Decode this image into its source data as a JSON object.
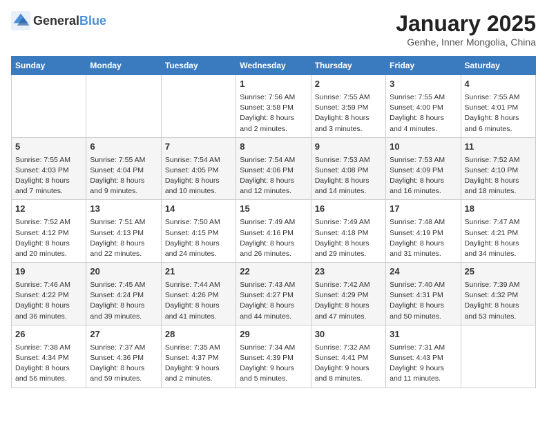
{
  "header": {
    "logo_general": "General",
    "logo_blue": "Blue",
    "title": "January 2025",
    "subtitle": "Genhe, Inner Mongolia, China"
  },
  "calendar": {
    "days_of_week": [
      "Sunday",
      "Monday",
      "Tuesday",
      "Wednesday",
      "Thursday",
      "Friday",
      "Saturday"
    ],
    "weeks": [
      [
        {
          "day": "",
          "content": ""
        },
        {
          "day": "",
          "content": ""
        },
        {
          "day": "",
          "content": ""
        },
        {
          "day": "1",
          "content": "Sunrise: 7:56 AM\nSunset: 3:58 PM\nDaylight: 8 hours\nand 2 minutes."
        },
        {
          "day": "2",
          "content": "Sunrise: 7:55 AM\nSunset: 3:59 PM\nDaylight: 8 hours\nand 3 minutes."
        },
        {
          "day": "3",
          "content": "Sunrise: 7:55 AM\nSunset: 4:00 PM\nDaylight: 8 hours\nand 4 minutes."
        },
        {
          "day": "4",
          "content": "Sunrise: 7:55 AM\nSunset: 4:01 PM\nDaylight: 8 hours\nand 6 minutes."
        }
      ],
      [
        {
          "day": "5",
          "content": "Sunrise: 7:55 AM\nSunset: 4:03 PM\nDaylight: 8 hours\nand 7 minutes."
        },
        {
          "day": "6",
          "content": "Sunrise: 7:55 AM\nSunset: 4:04 PM\nDaylight: 8 hours\nand 9 minutes."
        },
        {
          "day": "7",
          "content": "Sunrise: 7:54 AM\nSunset: 4:05 PM\nDaylight: 8 hours\nand 10 minutes."
        },
        {
          "day": "8",
          "content": "Sunrise: 7:54 AM\nSunset: 4:06 PM\nDaylight: 8 hours\nand 12 minutes."
        },
        {
          "day": "9",
          "content": "Sunrise: 7:53 AM\nSunset: 4:08 PM\nDaylight: 8 hours\nand 14 minutes."
        },
        {
          "day": "10",
          "content": "Sunrise: 7:53 AM\nSunset: 4:09 PM\nDaylight: 8 hours\nand 16 minutes."
        },
        {
          "day": "11",
          "content": "Sunrise: 7:52 AM\nSunset: 4:10 PM\nDaylight: 8 hours\nand 18 minutes."
        }
      ],
      [
        {
          "day": "12",
          "content": "Sunrise: 7:52 AM\nSunset: 4:12 PM\nDaylight: 8 hours\nand 20 minutes."
        },
        {
          "day": "13",
          "content": "Sunrise: 7:51 AM\nSunset: 4:13 PM\nDaylight: 8 hours\nand 22 minutes."
        },
        {
          "day": "14",
          "content": "Sunrise: 7:50 AM\nSunset: 4:15 PM\nDaylight: 8 hours\nand 24 minutes."
        },
        {
          "day": "15",
          "content": "Sunrise: 7:49 AM\nSunset: 4:16 PM\nDaylight: 8 hours\nand 26 minutes."
        },
        {
          "day": "16",
          "content": "Sunrise: 7:49 AM\nSunset: 4:18 PM\nDaylight: 8 hours\nand 29 minutes."
        },
        {
          "day": "17",
          "content": "Sunrise: 7:48 AM\nSunset: 4:19 PM\nDaylight: 8 hours\nand 31 minutes."
        },
        {
          "day": "18",
          "content": "Sunrise: 7:47 AM\nSunset: 4:21 PM\nDaylight: 8 hours\nand 34 minutes."
        }
      ],
      [
        {
          "day": "19",
          "content": "Sunrise: 7:46 AM\nSunset: 4:22 PM\nDaylight: 8 hours\nand 36 minutes."
        },
        {
          "day": "20",
          "content": "Sunrise: 7:45 AM\nSunset: 4:24 PM\nDaylight: 8 hours\nand 39 minutes."
        },
        {
          "day": "21",
          "content": "Sunrise: 7:44 AM\nSunset: 4:26 PM\nDaylight: 8 hours\nand 41 minutes."
        },
        {
          "day": "22",
          "content": "Sunrise: 7:43 AM\nSunset: 4:27 PM\nDaylight: 8 hours\nand 44 minutes."
        },
        {
          "day": "23",
          "content": "Sunrise: 7:42 AM\nSunset: 4:29 PM\nDaylight: 8 hours\nand 47 minutes."
        },
        {
          "day": "24",
          "content": "Sunrise: 7:40 AM\nSunset: 4:31 PM\nDaylight: 8 hours\nand 50 minutes."
        },
        {
          "day": "25",
          "content": "Sunrise: 7:39 AM\nSunset: 4:32 PM\nDaylight: 8 hours\nand 53 minutes."
        }
      ],
      [
        {
          "day": "26",
          "content": "Sunrise: 7:38 AM\nSunset: 4:34 PM\nDaylight: 8 hours\nand 56 minutes."
        },
        {
          "day": "27",
          "content": "Sunrise: 7:37 AM\nSunset: 4:36 PM\nDaylight: 8 hours\nand 59 minutes."
        },
        {
          "day": "28",
          "content": "Sunrise: 7:35 AM\nSunset: 4:37 PM\nDaylight: 9 hours\nand 2 minutes."
        },
        {
          "day": "29",
          "content": "Sunrise: 7:34 AM\nSunset: 4:39 PM\nDaylight: 9 hours\nand 5 minutes."
        },
        {
          "day": "30",
          "content": "Sunrise: 7:32 AM\nSunset: 4:41 PM\nDaylight: 9 hours\nand 8 minutes."
        },
        {
          "day": "31",
          "content": "Sunrise: 7:31 AM\nSunset: 4:43 PM\nDaylight: 9 hours\nand 11 minutes."
        },
        {
          "day": "",
          "content": ""
        }
      ]
    ]
  }
}
